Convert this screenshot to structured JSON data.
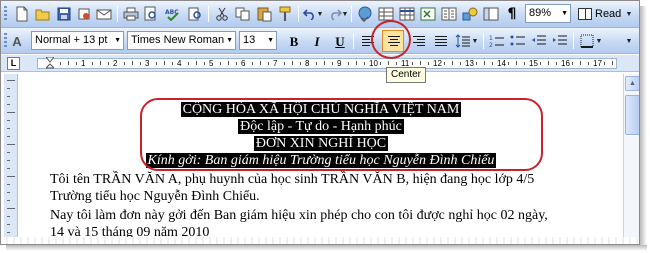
{
  "toolbar_standard": {
    "zoom": "89%",
    "read_label": "Read",
    "icons": [
      "new-doc-icon",
      "open-icon",
      "save-icon",
      "permission-icon",
      "email-icon",
      "print-icon",
      "print-preview-icon",
      "spelling-icon",
      "research-icon",
      "cut-icon",
      "copy-icon",
      "paste-icon",
      "format-painter-icon",
      "undo-icon",
      "redo-icon",
      "hyperlink-icon",
      "tables-borders-icon",
      "insert-table-icon",
      "insert-excel-icon",
      "columns-icon",
      "drawing-icon",
      "document-map-icon",
      "show-hide-icon"
    ]
  },
  "toolbar_formatting": {
    "style": "Normal + 13 pt",
    "font": "Times New Roman",
    "size": "13",
    "bold": "B",
    "italic": "I",
    "underline": "U"
  },
  "tooltip": "Center",
  "ruler": {
    "corner": "L",
    "numbers": [
      "1",
      "2",
      "3",
      "4",
      "5",
      "6",
      "7",
      "8",
      "9",
      "10",
      "11",
      "12",
      "13",
      "14",
      "15",
      "16",
      "17"
    ]
  },
  "document": {
    "header_lines": [
      "CỘNG HÒA XÃ HỘI CHỦ NGHĨA VIỆT NAM",
      "Độc lập - Tự do - Hạnh phúc",
      "ĐƠN XIN NGHỈ HỌC",
      "Kính gởi: Ban giám hiệu Trường tiểu học Nguyễn Đình Chiểu"
    ],
    "body_lines": [
      "Tôi tên TRẦN VĂN A, phụ huynh của học sinh TRẦN VĂN B, hiện đang học lớp 4/5",
      "Trường tiểu học Nguyễn Đình Chiểu.",
      "Nay tôi làm đơn này gởi đến Ban giám hiệu xin phép cho con tôi được nghỉ học 02 ngày,",
      "14 và 15 tháng 09 năm 2010"
    ]
  },
  "colors": {
    "annotation_red": "#c8232b",
    "toolbar_blue": "#c7daf4",
    "selection": "#000000"
  }
}
